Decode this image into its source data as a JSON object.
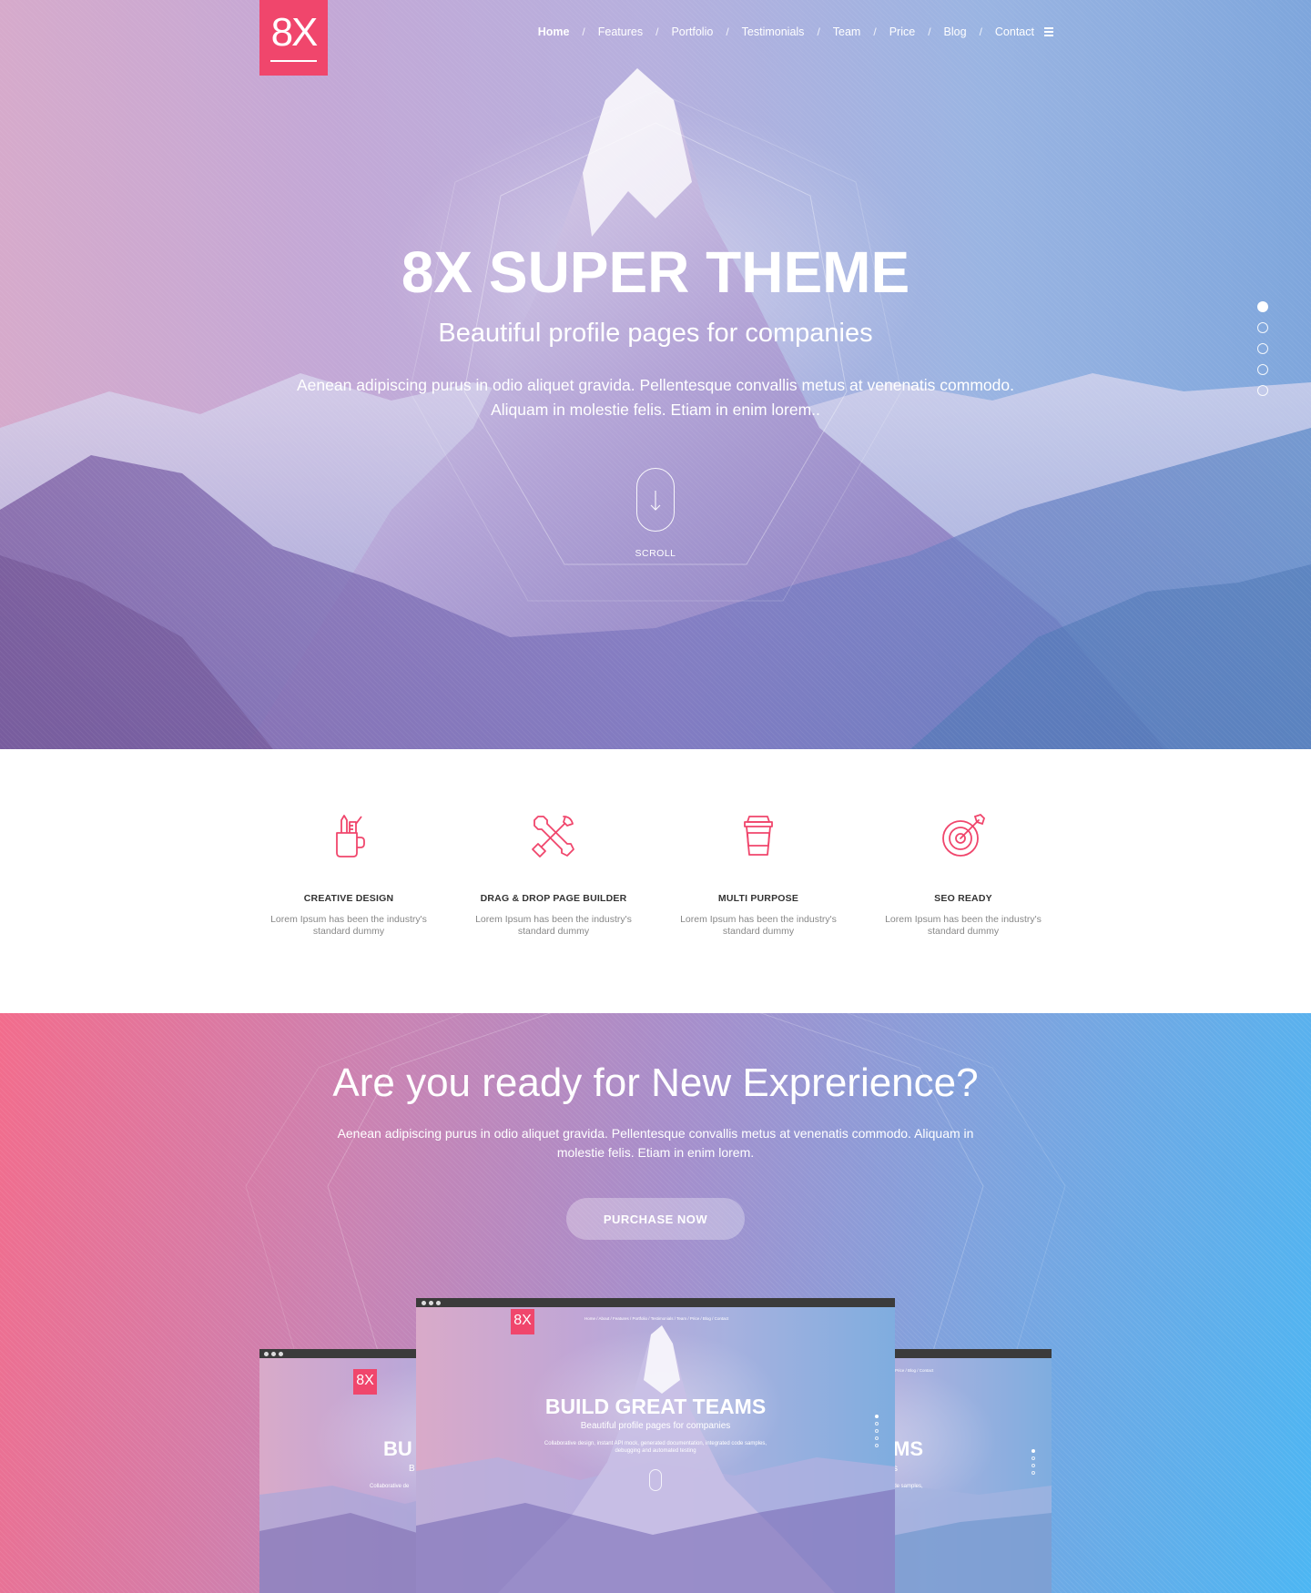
{
  "brand": {
    "logo_text": "8X",
    "accent_color": "#f0466c"
  },
  "nav": {
    "items": [
      "Home",
      "Features",
      "Portfolio",
      "Testimonials",
      "Team",
      "Price",
      "Blog",
      "Contact"
    ],
    "separator": "/",
    "active": "Home",
    "menu_icon": "hamburger-icon"
  },
  "hero": {
    "title": "8X SUPER THEME",
    "subtitle": "Beautiful profile pages for companies",
    "description_line1": "Aenean adipiscing purus in odio aliquet gravida. Pellentesque convallis metus at venenatis commodo.",
    "description_line2": "Aliquam in molestie felis. Etiam in enim lorem..",
    "scroll_label": "SCROLL",
    "slide_count": 5,
    "active_slide": 1
  },
  "features": [
    {
      "icon": "pencil-cup-icon",
      "title": "CREATIVE DESIGN",
      "text_line1": "Lorem Ipsum has been the industry's",
      "text_line2": "standard dummy"
    },
    {
      "icon": "tools-icon",
      "title": "DRAG & DROP PAGE BUILDER",
      "text_line1": "Lorem Ipsum has been the industry's",
      "text_line2": "standard dummy"
    },
    {
      "icon": "coffee-cup-icon",
      "title": "MULTI PURPOSE",
      "text_line1": "Lorem Ipsum has been the industry's",
      "text_line2": "standard dummy"
    },
    {
      "icon": "target-icon",
      "title": "SEO READY",
      "text_line1": "Lorem Ipsum has been the industry's",
      "text_line2": "standard dummy"
    }
  ],
  "cta": {
    "title": "Are you ready for New Exprerience?",
    "description_line1": "Aenean adipiscing purus in odio aliquet gravida. Pellentesque convallis metus at venenatis commodo. Aliquam in",
    "description_line2": "molestie felis. Etiam in enim lorem.",
    "button_label": "PURCHASE NOW"
  },
  "mockups": {
    "center": {
      "logo_text": "8X",
      "nav_text": "Home  /  About  /  Features  /  Portfolio  /  Testimonials  /  Team  /  Price  /  Blog  /  Contact",
      "title": "BUILD GREAT TEAMS",
      "subtitle": "Beautiful profile pages for companies",
      "small_line1": "Collaborative design, instant API mock, generated documentation, integrated code samples,",
      "small_line2": "debugging and automated testing"
    },
    "left": {
      "logo_text": "8X",
      "title_fragment": "BU",
      "sub_fragment": "B",
      "small_fragment": "Collaborative de"
    },
    "right": {
      "nav_fragment": "Price  /  Blog  /  Contact",
      "title_fragment": "MS",
      "sub_fragment": "s",
      "small_fragment": "code samples,"
    }
  }
}
